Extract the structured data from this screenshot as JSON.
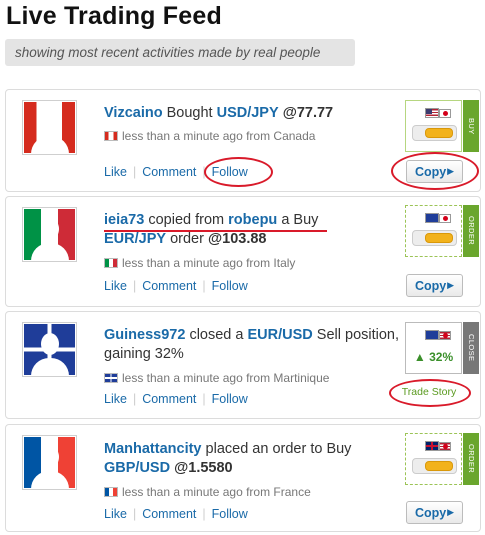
{
  "header": {
    "title": "Live Trading Feed",
    "subtitle": "showing most recent activities made by real people"
  },
  "actions": {
    "like": "Like",
    "comment": "Comment",
    "follow": "Follow",
    "copy": "Copy",
    "trade_story": "Trade Story"
  },
  "feed": [
    {
      "user": "Vizcaino",
      "verb": "Bought",
      "pair": "USD/JPY",
      "price": "@77.77",
      "meta": "less than a minute ago from Canada",
      "country_flag": "canada-flag",
      "tab": "BUY",
      "pair_flags": [
        "usa-flag",
        "japan-flag"
      ]
    },
    {
      "user": "ieia73",
      "verb": "copied from",
      "source_user": "robepu",
      "verb2": "a Buy",
      "pair": "EUR/JPY",
      "verb3": "order",
      "price": "@103.88",
      "meta": "less than a minute ago from Italy",
      "country_flag": "italy-flag",
      "tab": "ORDER",
      "pair_flags": [
        "eu-flag",
        "japan-flag"
      ]
    },
    {
      "user": "Guiness972",
      "verb": "closed a",
      "pair": "EUR/USD",
      "verb2": "Sell position,",
      "line2": "gaining 32%",
      "meta": "less than a minute ago from Martinique",
      "country_flag": "martinique-flag",
      "tab": "CLOSE",
      "gain": "32%",
      "pair_flags": [
        "eu-flag",
        "usa-flag"
      ]
    },
    {
      "user": "Manhattancity",
      "verb": "placed an order to Buy",
      "pair": "GBP/USD",
      "price": "@1.5580",
      "meta": "less than a minute ago from France",
      "country_flag": "france-flag",
      "tab": "ORDER",
      "pair_flags": [
        "uk-flag",
        "usa-flag"
      ]
    }
  ],
  "colors": {
    "link": "#1a6aa8",
    "highlight_ring": "#d91a2a",
    "buy_tab": "#6aa62d",
    "close_tab": "#777777",
    "gain": "#3a8f2a"
  }
}
